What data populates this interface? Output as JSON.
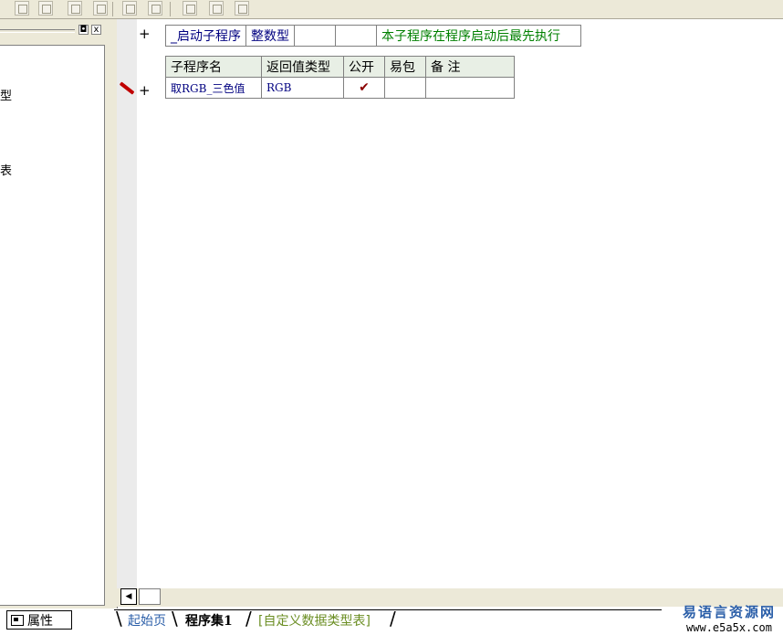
{
  "left_panel": {
    "fragments": [
      "型",
      "表"
    ],
    "pin_icon": "pin-icon",
    "close_label": "x",
    "properties_tab_label": "属性"
  },
  "startup_row": {
    "name": "_启动子程序",
    "return_type": "整数型",
    "public": "",
    "easy_pack": "",
    "remark": "本子程序在程序启动后最先执行"
  },
  "sub_table": {
    "headers": [
      "子程序名",
      "返回值类型",
      "公开",
      "易包",
      "备 注"
    ],
    "rows": [
      {
        "name": "取RGB_三色值",
        "return_type": "RGB",
        "public": "✔",
        "easy_pack": "",
        "remark": ""
      }
    ]
  },
  "gutter": {
    "plus_symbol": "+"
  },
  "tabs": [
    {
      "label": "起始页"
    },
    {
      "label": "程序集1",
      "active": true
    },
    {
      "label": "[自定义数据类型表]"
    }
  ],
  "branding": {
    "cn": "易语言资源网",
    "url": "www.e5a5x.com"
  },
  "colors": {
    "accent_green": "#008000",
    "link_blue": "#000080",
    "pencil_red": "#c00000"
  }
}
